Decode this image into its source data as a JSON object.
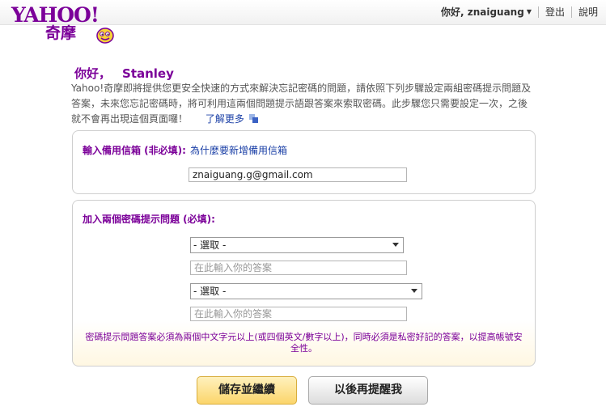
{
  "brand": {
    "logo_text": "YAHOO!",
    "logo_cn": "奇摩"
  },
  "header": {
    "greeting": "你好, znaiguang",
    "signout": "登出",
    "help": "說明"
  },
  "main": {
    "hello_label": "你好，",
    "hello_name": "Stanley",
    "intro_text": "Yahoo!奇摩即將提供您更安全快速的方式來解決忘記密碼的問題，請依照下列步驟設定兩組密碼提示問題及答案，未來您忘記密碼時，將可利用這兩個問題提示語跟答案來索取密碼。此步驟您只需要設定一次，之後就不會再出現這個頁面囉！",
    "learn_more": "了解更多"
  },
  "backup_email": {
    "title": "輸入備用信箱  (非必填):",
    "why_link": "為什麼要新增備用信箱",
    "value": "znaiguang.g@gmail.com"
  },
  "questions": {
    "title": "加入兩個密碼提示問題  (必填):",
    "q1_selected": "- 選取  -",
    "a1_placeholder": "在此輸入你的答案",
    "q2_selected": "- 選取  -",
    "a2_placeholder": "在此輸入你的答案",
    "notice": "密碼提示問題答案必須為兩個中文字元以上(或四個英文/數字以上)，同時必須是私密好記的答案，以提高帳號安全性。"
  },
  "buttons": {
    "save": "儲存並繼續",
    "later": "以後再提醒我"
  },
  "colors": {
    "brand_purple": "#7b0099",
    "link_blue": "#1a3fa6",
    "save_button": "#fbd56b"
  }
}
